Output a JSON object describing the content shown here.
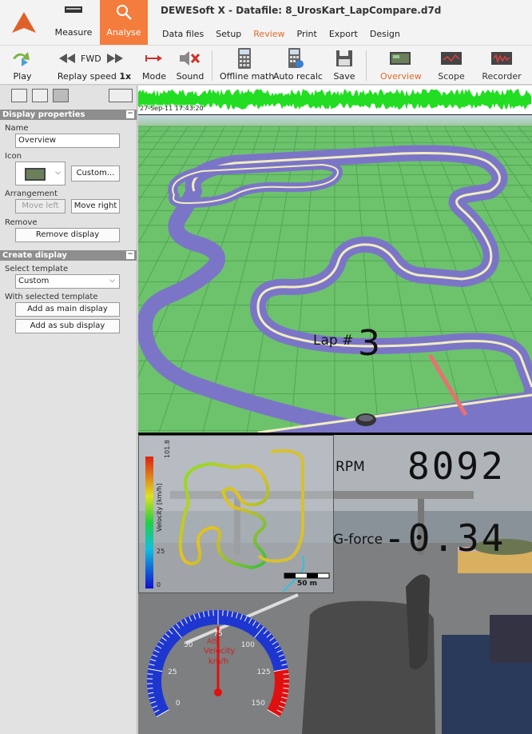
{
  "app": {
    "title": "DEWESoft X - Datafile: 8_UrosKart_LapCompare.d7d",
    "modes": {
      "measure": "Measure",
      "analyse": "Analyse"
    },
    "menu": [
      "Data files",
      "Setup",
      "Review",
      "Print",
      "Export",
      "Design"
    ],
    "active_menu": "Review",
    "accent": "#f47c3c"
  },
  "toolbar": {
    "play": "Play",
    "fwd": "FWD",
    "replay_speed_label": "Replay speed",
    "replay_speed_value": "1x",
    "mode": "Mode",
    "sound": "Sound",
    "offline_math": "Offline math",
    "auto_recalc": "Auto recalc",
    "save": "Save",
    "overview": "Overview",
    "scope": "Scope",
    "recorder": "Recorder"
  },
  "display_properties": {
    "header": "Display properties",
    "name_label": "Name",
    "name_value": "Overview",
    "icon_label": "Icon",
    "custom_button": "Custom...",
    "arrangement_label": "Arrangement",
    "move_left": "Move left",
    "move_right": "Move right",
    "remove_label": "Remove",
    "remove_display": "Remove display"
  },
  "create_display": {
    "header": "Create display",
    "select_template_label": "Select template",
    "template_value": "Custom",
    "with_selected_label": "With selected template",
    "add_main": "Add as main display",
    "add_sub": "Add as sub display"
  },
  "viewer": {
    "timestamp": "27-Sep-11 17:43:20",
    "lap_label": "Lap #",
    "lap_value": "3",
    "rpm_label": "RPM",
    "rpm_value": "8092",
    "gforce_label": "G-force",
    "gforce_value": "-0.34",
    "map_axis_label": "Velocity [km/h]",
    "map_axis_top": "101.8",
    "map_axis_mid": "25",
    "map_axis_bottom": "0",
    "map_scale": "50 m",
    "gauge_title_1": "AIS",
    "gauge_title_2": "Velocity",
    "gauge_unit": "km/h",
    "gauge_ticks": [
      "0",
      "25",
      "50",
      "75",
      "100",
      "125",
      "150"
    ],
    "gauge_value": 75
  }
}
